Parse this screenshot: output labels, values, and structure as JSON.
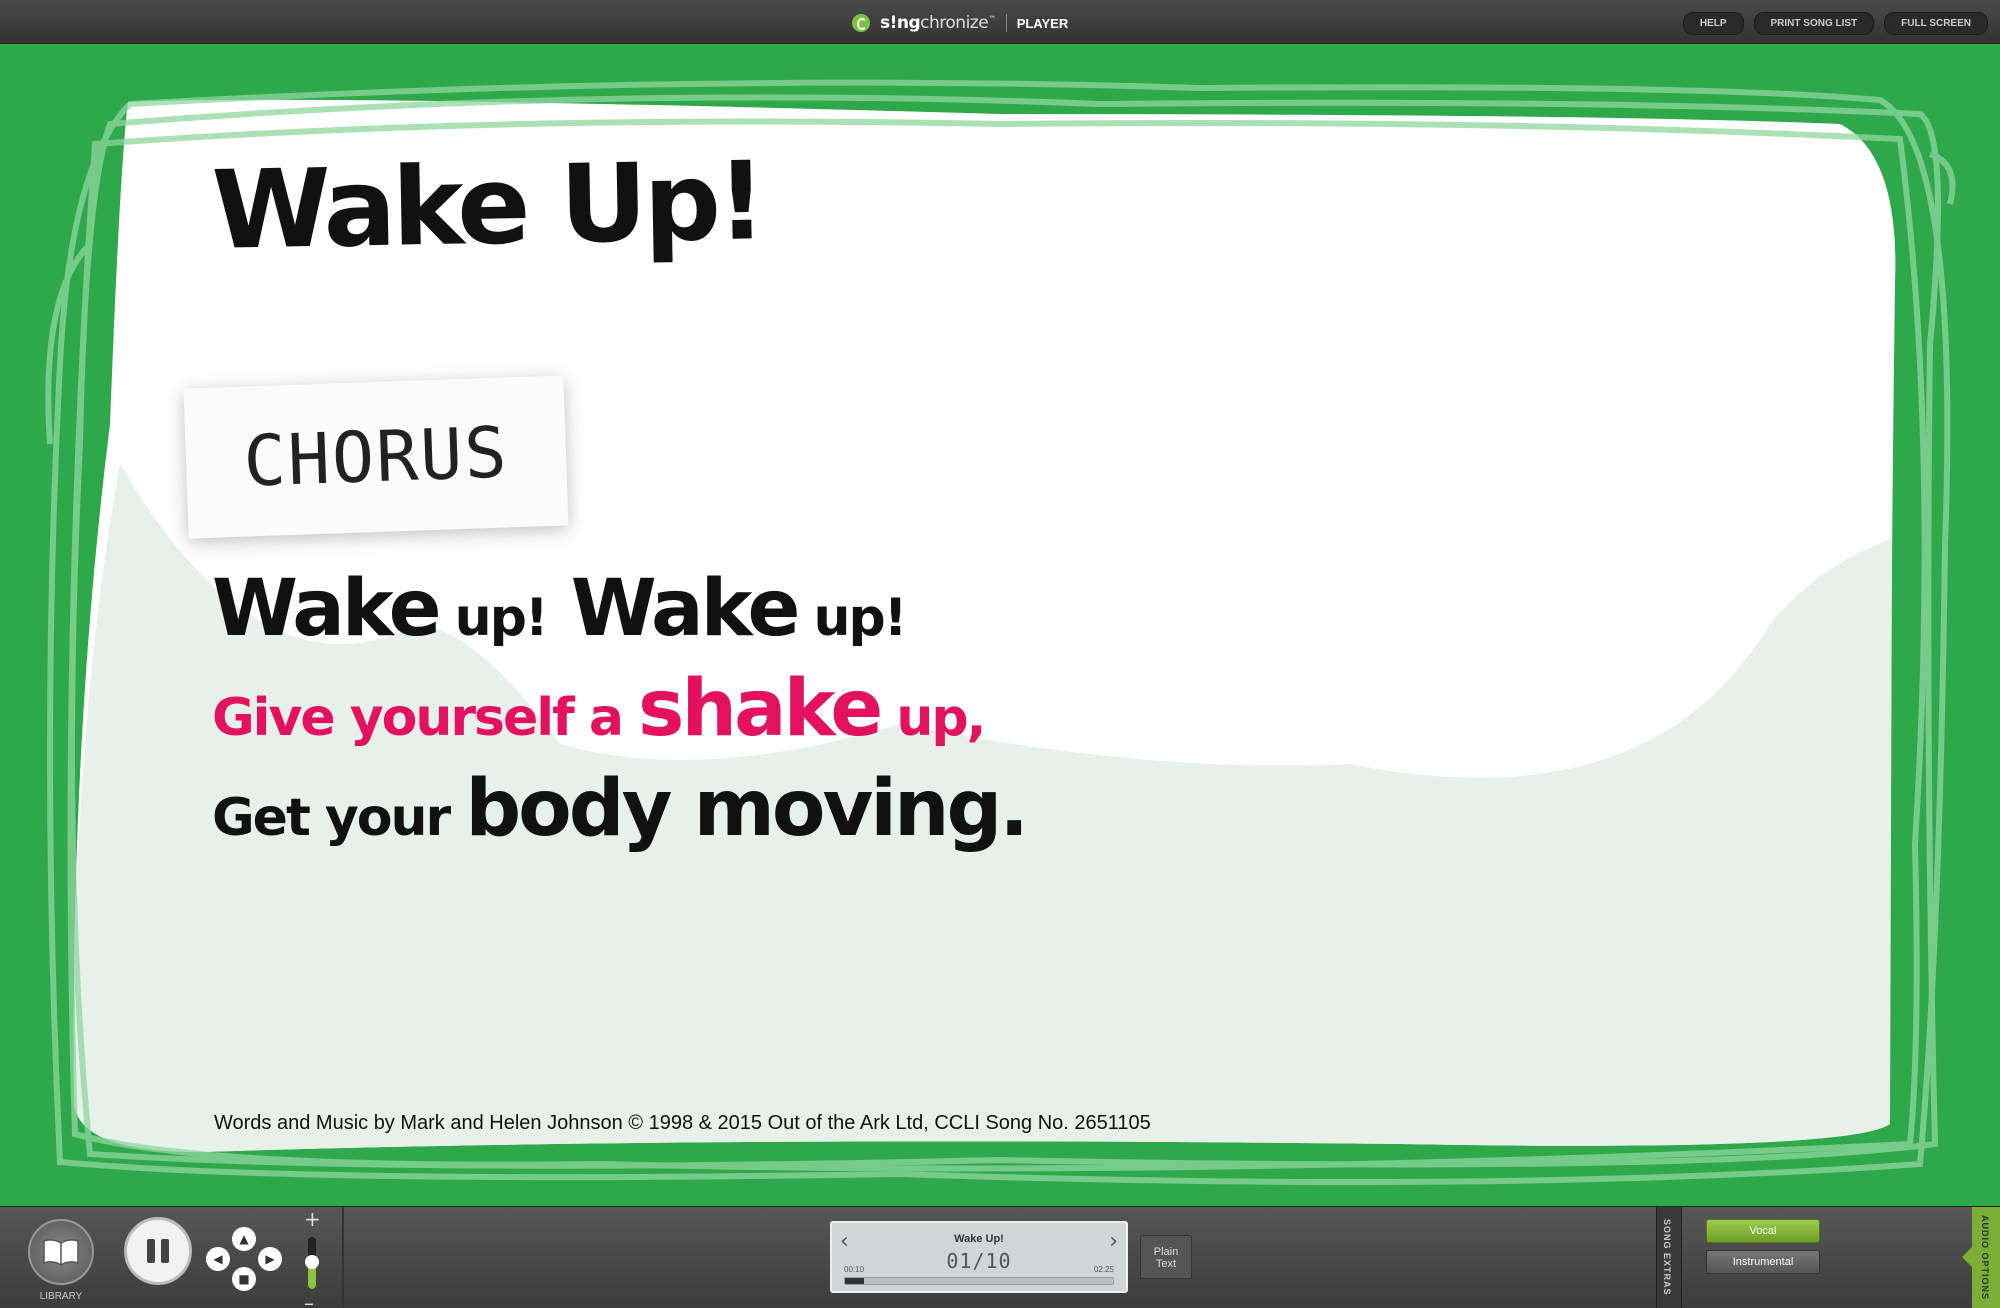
{
  "app": {
    "brand_sing": "s!ng",
    "brand_chronize": "chronize",
    "brand_tm": "™",
    "section": "PLAYER"
  },
  "top_links": [
    "HELP",
    "PRINT SONG LIST",
    "FULL SCREEN"
  ],
  "slide": {
    "title": "Wake Up!",
    "section_tag": "CHORUS",
    "line1": [
      "Wake",
      " up!",
      " Wake",
      " up!"
    ],
    "line2": [
      "Give yourself a ",
      "shake",
      " up,"
    ],
    "line3": [
      "Get your ",
      "body",
      " moving."
    ],
    "credit": "Words and Music by Mark and Helen Johnson © 1998 & 2015 Out of the Ark Ltd, CCLI Song No. 2651105",
    "colors": {
      "background": "#2ea84a",
      "paper": "#ffffff",
      "highlight": "#e3115f"
    }
  },
  "controls": {
    "library_label": "LIBRARY",
    "volume_plus": "+",
    "volume_minus": "–",
    "volume_level": 0.45
  },
  "display": {
    "prev_icon": "chevron-left-icon",
    "next_icon": "chevron-right-icon",
    "song_title": "Wake Up!",
    "slide_counter": "01/10",
    "time_elapsed": "00:10",
    "time_total": "02:25",
    "progress": 0.07
  },
  "plain_text_button": [
    "Plain",
    "Text"
  ],
  "song_extras_label": "SONG EXTRAS",
  "audio": {
    "vocal_label": "Vocal",
    "instrumental_label": "Instrumental",
    "tab_label": "AUDIO OPTIONS",
    "selected": "Vocal"
  }
}
